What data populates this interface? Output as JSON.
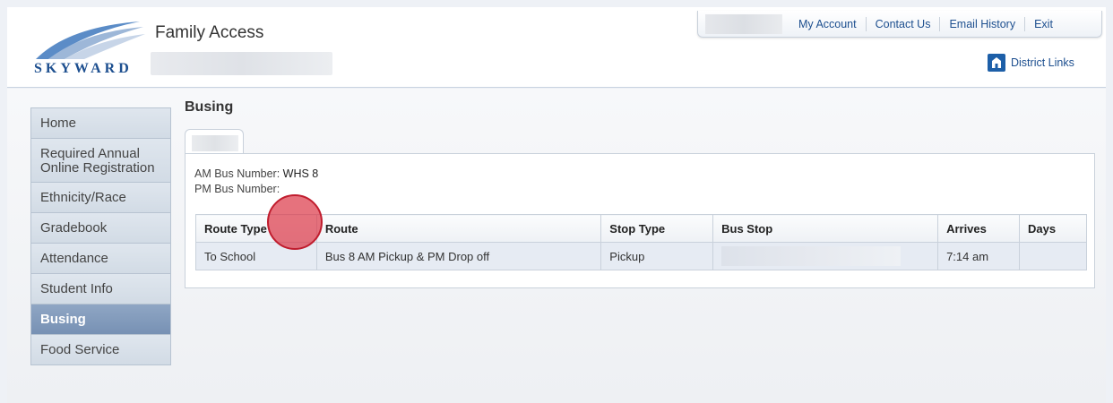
{
  "header": {
    "logo_text": "SKYWARD",
    "app_title": "Family Access",
    "top_links": [
      "My Account",
      "Contact Us",
      "Email History",
      "Exit"
    ],
    "district_links": "District Links"
  },
  "sidebar": {
    "items": [
      {
        "label": "Home",
        "active": false
      },
      {
        "label": "Required Annual Online Registration",
        "active": false
      },
      {
        "label": "Ethnicity/Race",
        "active": false
      },
      {
        "label": "Gradebook",
        "active": false
      },
      {
        "label": "Attendance",
        "active": false
      },
      {
        "label": "Student Info",
        "active": false
      },
      {
        "label": "Busing",
        "active": true
      },
      {
        "label": "Food Service",
        "active": false
      }
    ]
  },
  "main": {
    "title": "Busing",
    "am_bus_label": "AM Bus Number:",
    "am_bus_value": "WHS 8",
    "pm_bus_label": "PM Bus Number:",
    "pm_bus_value": "",
    "table": {
      "headers": [
        "Route Type",
        "Route",
        "Stop Type",
        "Bus Stop",
        "Arrives",
        "Days"
      ],
      "rows": [
        {
          "route_type": "To School",
          "route": "Bus 8 AM Pickup & PM Drop off",
          "stop_type": "Pickup",
          "bus_stop": "",
          "arrives": "7:14 am",
          "days": ""
        }
      ]
    }
  },
  "colors": {
    "brand_blue": "#1d4f8f",
    "active_nav": "#7f98b9",
    "click_marker": "#dc3c4b"
  }
}
